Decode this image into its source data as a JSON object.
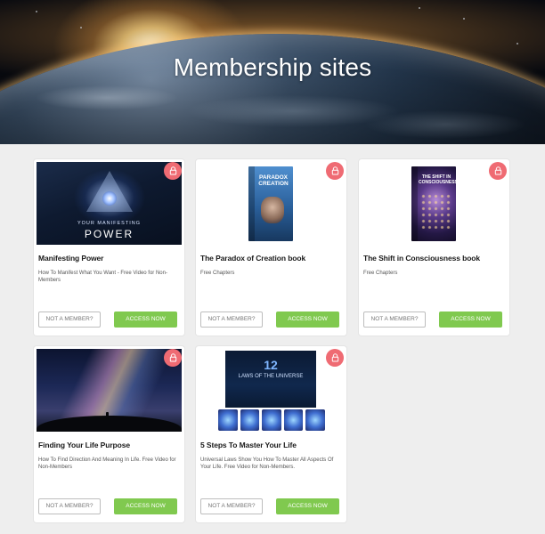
{
  "page": {
    "title": "Membership sites"
  },
  "cards": [
    {
      "title": "Manifesting Power",
      "description": "How To Manifest What You Want - Free Video for Non-Members",
      "not_member_label": "NOT A MEMBER?",
      "access_label": "ACCESS NOW",
      "thumb": {
        "small": "YOUR MANIFESTING",
        "big": "POWER"
      }
    },
    {
      "title": "The Paradox of Creation book",
      "description": "Free Chapters",
      "not_member_label": "NOT A MEMBER?",
      "access_label": "ACCESS NOW",
      "thumb": {
        "book_title": "PARADOX CREATION"
      }
    },
    {
      "title": "The Shift in Consciousness book",
      "description": "Free Chapters",
      "not_member_label": "NOT A MEMBER?",
      "access_label": "ACCESS NOW",
      "thumb": {
        "book_title": "THE SHIFT IN CONSCIOUSNESS"
      }
    },
    {
      "title": "Finding Your Life Purpose",
      "description": "How To Find Direction And Meaning In Life. Free Video for Non-Members",
      "not_member_label": "NOT A MEMBER?",
      "access_label": "ACCESS NOW"
    },
    {
      "title": "5 Steps To Master Your Life",
      "description": "Universal Laws Show You How To Master All Aspects Of Your Life. Free Video for Non-Members.",
      "not_member_label": "NOT A MEMBER?",
      "access_label": "ACCESS NOW",
      "thumb": {
        "number": "12",
        "label": "LAWS OF THE UNIVERSE"
      }
    }
  ],
  "colors": {
    "lock_badge": "#ef6b73",
    "access_button": "#80c94f",
    "background": "#eeeeee"
  },
  "icons": {
    "lock": "lock-icon"
  }
}
